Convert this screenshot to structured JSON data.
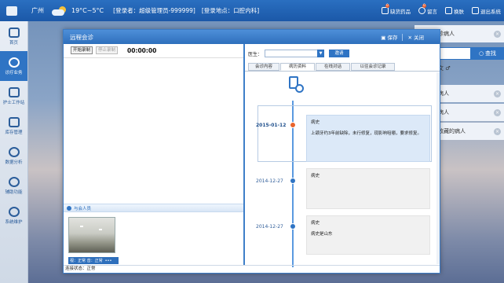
{
  "topbar": {
    "city": "广州",
    "temperature": "19°C~5°C",
    "user": "[登录者：超级管理员-999999]",
    "location": "[登录地点：口腔内科]",
    "actions": [
      {
        "label": "缺货药品",
        "badge": "0"
      },
      {
        "label": "留言",
        "badge": "0"
      },
      {
        "label": "换肤",
        "badge": ""
      },
      {
        "label": "退出系统",
        "badge": ""
      }
    ]
  },
  "leftnav": {
    "items": [
      {
        "label": "首页",
        "active": false
      },
      {
        "label": "诊疗业务",
        "active": true
      },
      {
        "label": "护士工作站",
        "active": false
      },
      {
        "label": "库存管理",
        "active": false
      },
      {
        "label": "数据分析",
        "active": false
      },
      {
        "label": "辅助功能",
        "active": false
      },
      {
        "label": "系统维护",
        "active": false
      }
    ]
  },
  "background": {
    "rows": [
      "诊病人",
      "病人",
      "病人",
      "收藏的病人"
    ],
    "search_label": "查找",
    "gender_text": "文"
  },
  "modal": {
    "title": "远程会诊",
    "save_label": "保存",
    "close_label": "关闭",
    "start_record": "开始录制",
    "stop_record": "停止录制",
    "timer": "00:00:00",
    "participants_label": "与会人员",
    "camera_status": "视：正常  音：正常",
    "camera_more": "•••",
    "connection_status": "连接状态：正常",
    "doctor_label": "医生：",
    "doctor_value": "",
    "invite_label": "邀请",
    "tabs": [
      {
        "label": "会诊内容",
        "active": false
      },
      {
        "label": "病历资料",
        "active": true
      },
      {
        "label": "在线对话",
        "active": false
      },
      {
        "label": "以往会诊记录",
        "active": false
      }
    ],
    "timeline": [
      {
        "date": "2015-01-12",
        "title": "病史",
        "text": "上颌牙约3年前缺除，未行修复，现影响咀嚼，要求修复。",
        "current": true
      },
      {
        "date": "2014-12-27",
        "title": "病史",
        "text": "",
        "current": false
      },
      {
        "date": "2014-12-27",
        "title": "病史",
        "text": "病史是山东",
        "current": false
      }
    ]
  }
}
